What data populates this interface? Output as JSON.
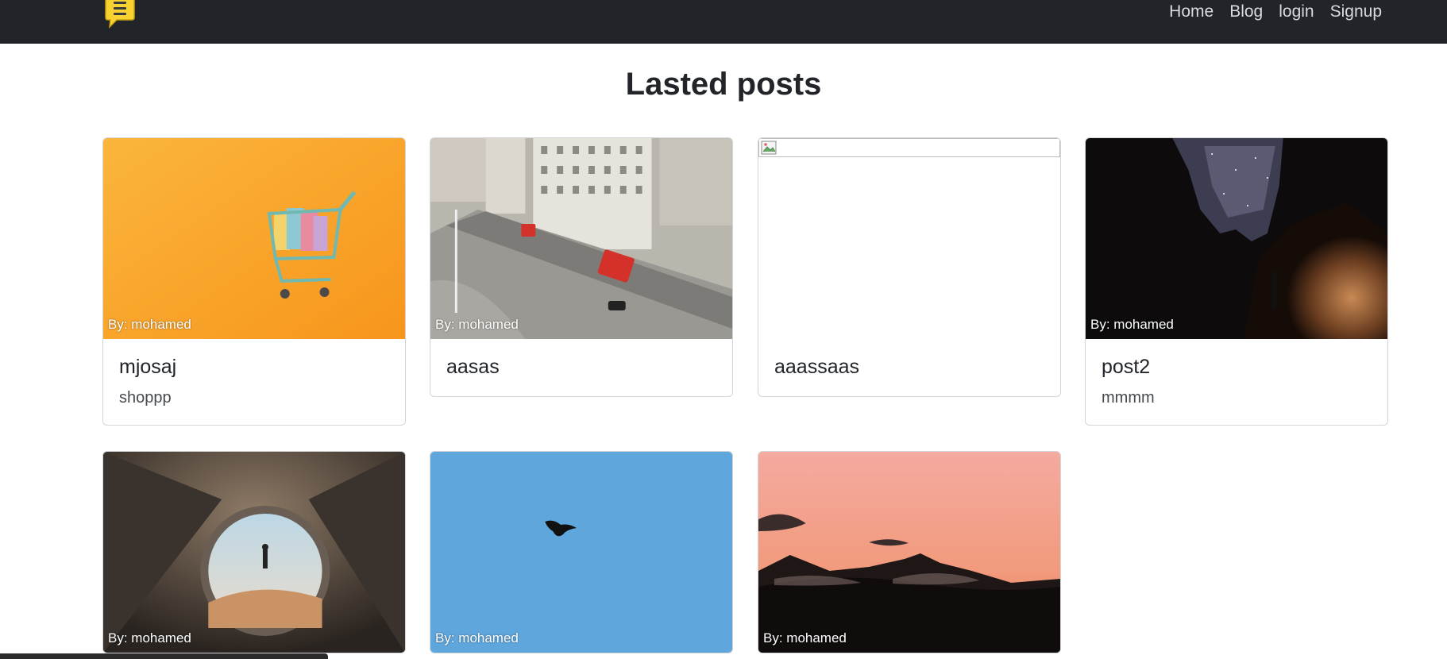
{
  "nav": {
    "brand_icon": "notes-chat-icon",
    "links": [
      "Home",
      "Blog",
      "login",
      "Signup"
    ]
  },
  "page_title": "Lasted posts",
  "posts": [
    {
      "author": "By: mohamed",
      "title": "mjosaj",
      "text": "shoppp",
      "image": "shopping-cart-on-orange"
    },
    {
      "author": "By: mohamed",
      "title": "aasas",
      "text": "",
      "image": "city-bridge-with-red-bus"
    },
    {
      "author": "",
      "title": "aaassaas",
      "text": "",
      "image": "broken-image"
    },
    {
      "author": "By: mohamed",
      "title": "post2",
      "text": "mmmm",
      "image": "night-sky-canyon"
    },
    {
      "author": "By: mohamed",
      "title": "",
      "text": "",
      "image": "tent-view-desert"
    },
    {
      "author": "By: mohamed",
      "title": "",
      "text": "",
      "image": "bird-in-blue-sky"
    },
    {
      "author": "By: mohamed",
      "title": "",
      "text": "",
      "image": "pink-sunset-mountains"
    }
  ],
  "colors": {
    "navbar": "#212529",
    "nav_link": "#d9dadb",
    "brand_yellow": "#f7d230"
  }
}
